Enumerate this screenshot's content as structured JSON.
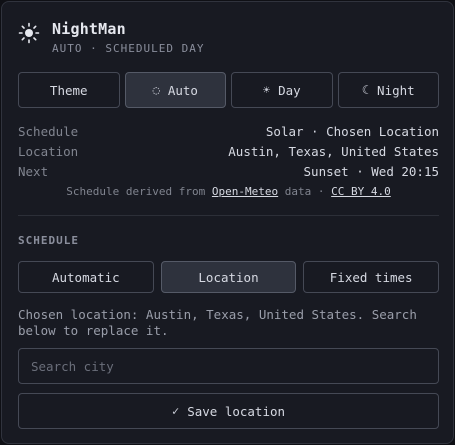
{
  "app": {
    "title": "NightMan",
    "subtitle": "AUTO · SCHEDULED DAY",
    "icon": "sun-icon"
  },
  "modes": [
    {
      "label": "Theme",
      "glyph": "",
      "active": false
    },
    {
      "label": "Auto",
      "glyph": "◌",
      "active": true
    },
    {
      "label": "Day",
      "glyph": "☀",
      "active": false
    },
    {
      "label": "Night",
      "glyph": "☾",
      "active": false
    }
  ],
  "info": [
    {
      "key": "Schedule",
      "value": "Solar · Chosen Location"
    },
    {
      "key": "Location",
      "value": "Austin, Texas, United States"
    },
    {
      "key": "Next",
      "value": "Sunset · Wed 20:15"
    }
  ],
  "attribution": {
    "prefix": "Schedule derived from",
    "link1": "Open-Meteo",
    "middle": "data ·",
    "link2": "CC BY 4.0"
  },
  "schedule": {
    "label": "SCHEDULE",
    "tabs": [
      {
        "label": "Automatic",
        "active": false
      },
      {
        "label": "Location",
        "active": true
      },
      {
        "label": "Fixed times",
        "active": false
      }
    ],
    "help": "Chosen location: Austin, Texas, United States. Search below to replace it.",
    "search_placeholder": "Search city",
    "search_value": "",
    "save_label": "Save location",
    "save_glyph": "✓"
  },
  "colors": {
    "background": "#181a22",
    "border": "#454955",
    "active": "#2e323d",
    "text": "#d6d9e2",
    "muted": "#80848f"
  }
}
